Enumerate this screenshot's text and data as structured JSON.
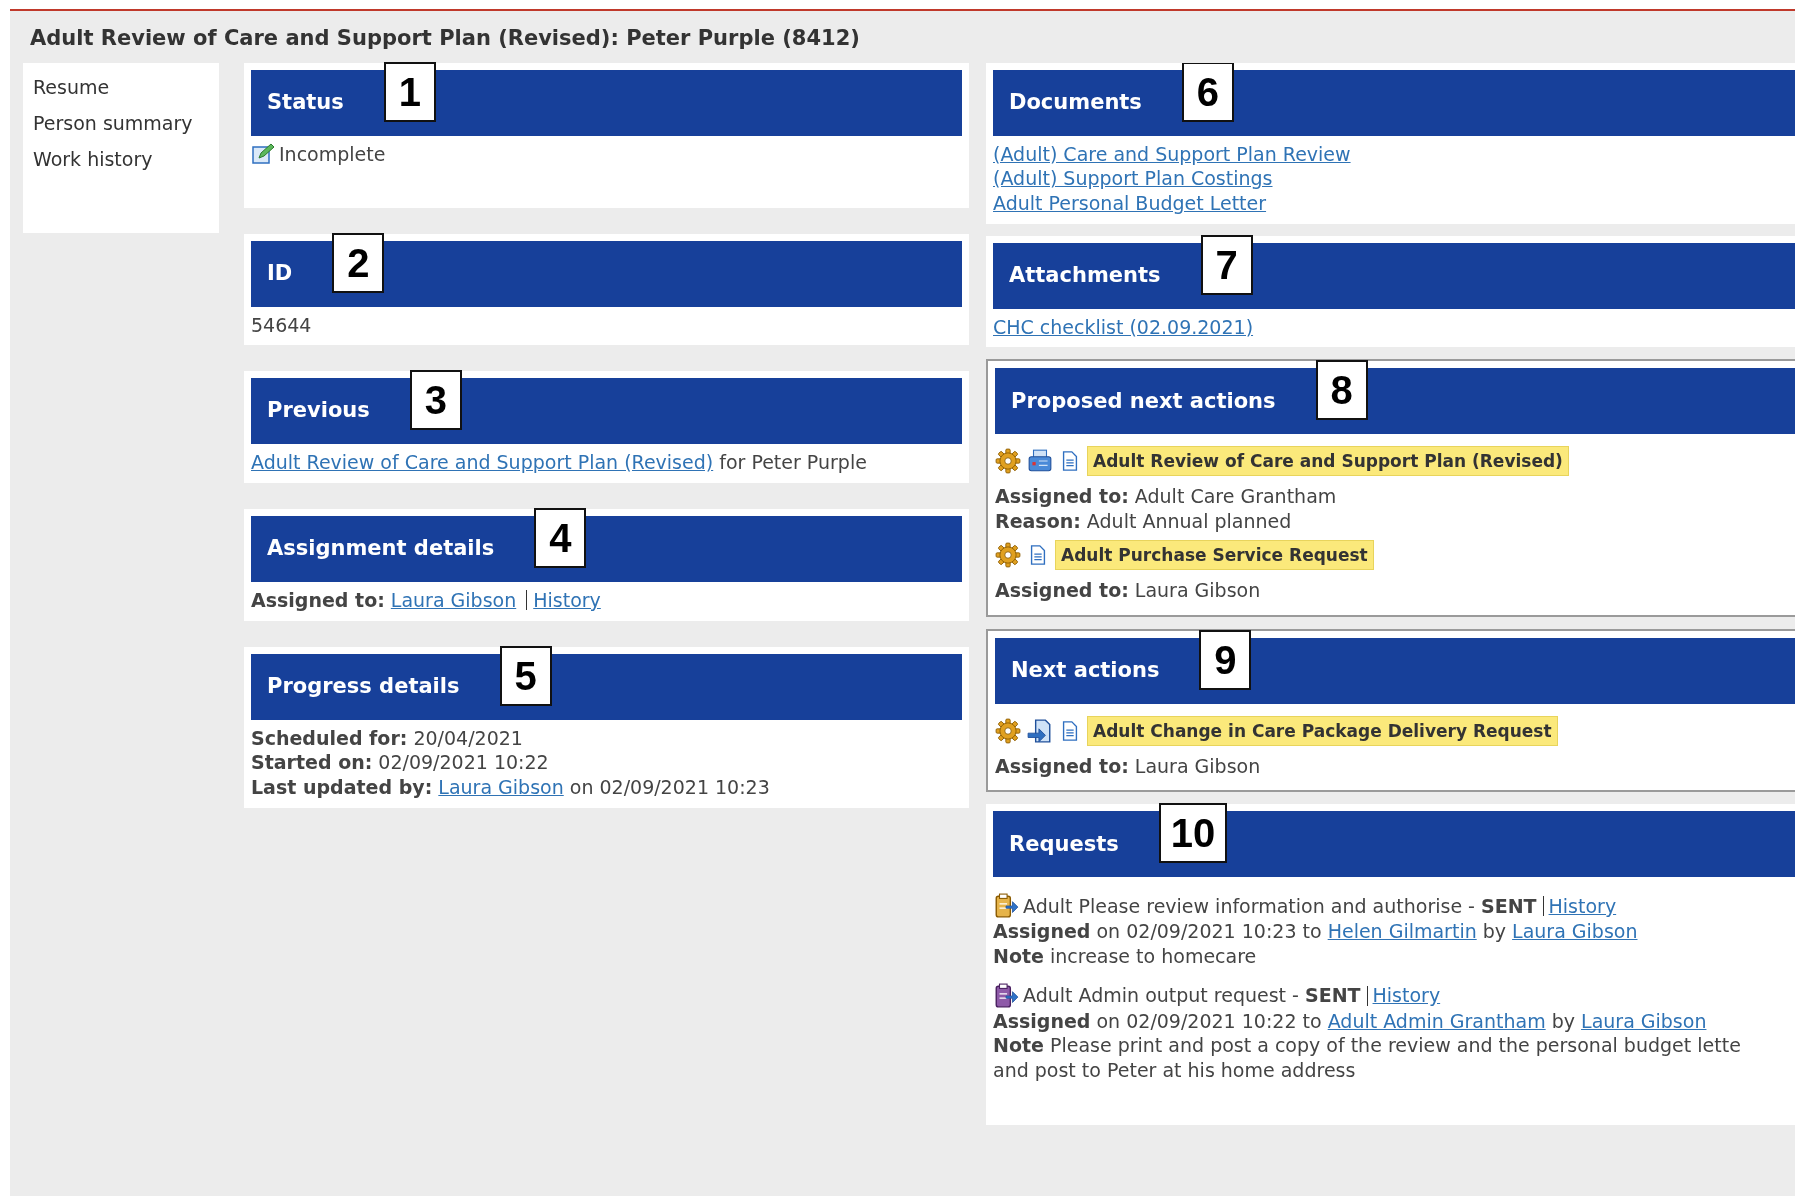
{
  "page_title": "Adult Review of Care and Support Plan (Revised): Peter Purple (8412)",
  "sidebar": {
    "items": [
      {
        "label": "Resume"
      },
      {
        "label": "Person summary"
      },
      {
        "label": "Work history"
      }
    ]
  },
  "left_panels": [
    {
      "kind": "status",
      "title": "Status",
      "callout": "1",
      "value": "Incomplete"
    },
    {
      "kind": "id",
      "title": "ID",
      "callout": "2",
      "value": "54644"
    },
    {
      "kind": "previous",
      "title": "Previous",
      "callout": "3",
      "link": "Adult Review of Care and Support Plan (Revised)",
      "suffix": "for Peter Purple"
    },
    {
      "kind": "assignment",
      "title": "Assignment details",
      "callout": "4",
      "label": "Assigned to:",
      "link": "Laura Gibson",
      "history": "History"
    },
    {
      "kind": "progress",
      "title": "Progress details",
      "callout": "5",
      "lines": [
        "**Scheduled for:** 20/04/2021",
        "**Started on:** 02/09/2021 10:22"
      ],
      "updated": {
        "label": "Last updated by:",
        "link": "Laura Gibson",
        "suffix": "on 02/09/2021 10:23"
      }
    }
  ],
  "right_panels": [
    {
      "kind": "links",
      "title": "Documents",
      "callout": "6",
      "links": [
        "(Adult) Care and Support Plan Review",
        "(Adult) Support Plan Costings",
        "Adult Personal Budget Letter"
      ]
    },
    {
      "kind": "links",
      "title": "Attachments",
      "callout": "7",
      "links": [
        "CHC checklist (02.09.2021)"
      ]
    },
    {
      "kind": "actions",
      "title": "Proposed next actions",
      "callout": "8",
      "items": [
        {
          "kind": "print",
          "label": "Adult Review of Care and Support Plan (Revised)",
          "details": [
            "**Assigned to:** Adult Care Grantham",
            "**Reason:** Adult Annual planned"
          ]
        },
        {
          "kind": "plain",
          "label": "Adult Purchase Service Request",
          "details": [
            "**Assigned to:** Laura Gibson"
          ]
        }
      ]
    },
    {
      "kind": "actions",
      "title": "Next actions",
      "callout": "9",
      "items": [
        {
          "kind": "transfer",
          "label": "Adult Change in Care Package Delivery Request",
          "details": [
            "**Assigned to:** Laura Gibson"
          ]
        }
      ]
    },
    {
      "kind": "requests",
      "title": "Requests",
      "callout": "10",
      "items": [
        {
          "kind": "authorise",
          "title": "Adult Please review information and authorise - **SENT**",
          "history": "History",
          "assigned": {
            "label": "Assigned",
            "text": "on 02/09/2021 10:23 to",
            "to": "Helen Gilmartin",
            "by": "by",
            "by_link": "Laura Gibson"
          },
          "note": [
            "**Note** increase to homecare"
          ]
        },
        {
          "kind": "output",
          "title": "Adult Admin output request - **SENT**",
          "history": "History",
          "assigned": {
            "label": "Assigned",
            "text": "on 02/09/2021 10:22 to",
            "to": "Adult Admin Grantham",
            "by": "by",
            "by_link": "Laura Gibson"
          },
          "note": [
            "**Note** Please print and post a copy of the review and the personal budget lette",
            "and post to Peter at his home address"
          ]
        }
      ]
    }
  ]
}
